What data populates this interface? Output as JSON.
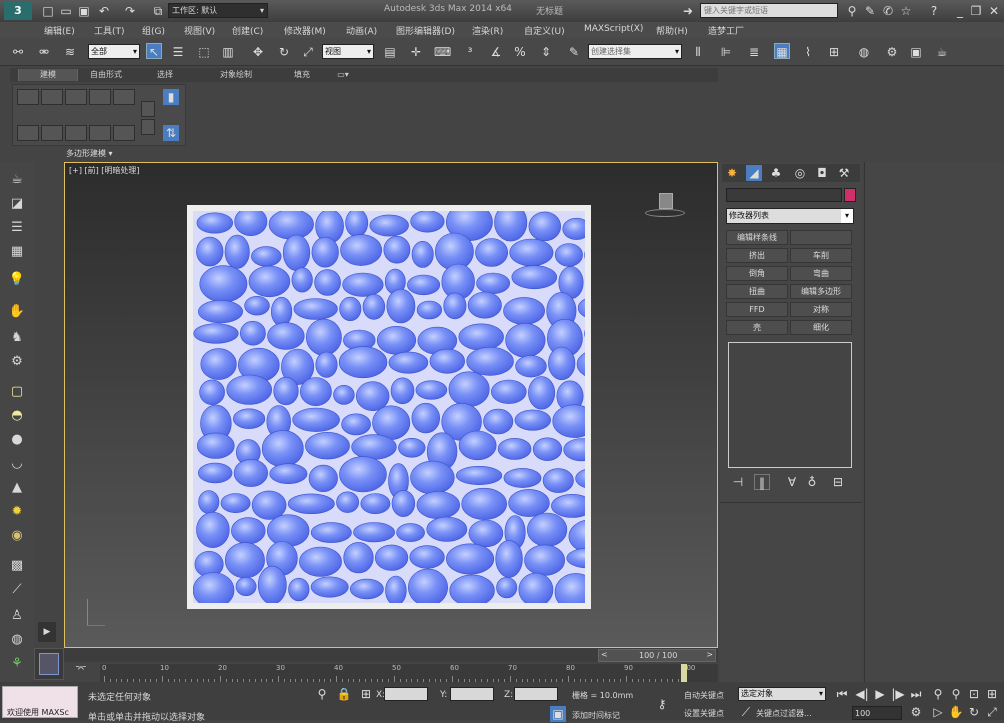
{
  "titlebar": {
    "workspace_label": "工作区: 默认",
    "app_title": "Autodesk 3ds Max  2014 x64",
    "doc_title": "无标题",
    "search_placeholder": "键入关键字或短语"
  },
  "menu": [
    "编辑(E)",
    "工具(T)",
    "组(G)",
    "视图(V)",
    "创建(C)",
    "修改器(M)",
    "动画(A)",
    "图形编辑器(D)",
    "渲染(R)",
    "自定义(U)",
    "MAXScript(X)",
    "帮助(H)",
    "造梦工厂"
  ],
  "toolbar": {
    "selection_filter": "全部",
    "ref_coord": "视图",
    "named_selection_placeholder": "创建选择集"
  },
  "ribbon": {
    "tabs": [
      "建模",
      "自由形式",
      "选择",
      "对象绘制",
      "填充"
    ],
    "panel_label": "多边形建模 ▾"
  },
  "viewport": {
    "label": "[+] [前] [明暗处理]",
    "progress_text": "100 / 100"
  },
  "command_panel": {
    "modifier_list_label": "修改器列表",
    "modifiers": [
      "编辑样条线",
      "挤出",
      "车削",
      "倒角",
      "弯曲",
      "扭曲",
      "编辑多边形",
      "FFD",
      "对称",
      "壳",
      "细化"
    ]
  },
  "timeline": {
    "ticks": [
      "0",
      "10",
      "20",
      "30",
      "40",
      "50",
      "60",
      "70",
      "80",
      "90",
      "100"
    ]
  },
  "status": {
    "left_badge": "欢迎使用 MAXSc",
    "selection_status": "未选定任何对象",
    "prompt": "单击或单击并拖动以选择对象",
    "x_label": "X:",
    "y_label": "Y:",
    "z_label": "Z:",
    "grid": "栅格 = 10.0mm",
    "add_time_tag": "添加时间标记",
    "auto_key": "自动关键点",
    "set_key": "设置关键点",
    "selected_dropdown": "选定对象",
    "key_filters": "关键点过滤器...",
    "frame": "100"
  },
  "colors": {
    "stone_blue": "#5f7bf0",
    "swatch": "#d0306a",
    "viewport_border": "#e0c060"
  }
}
